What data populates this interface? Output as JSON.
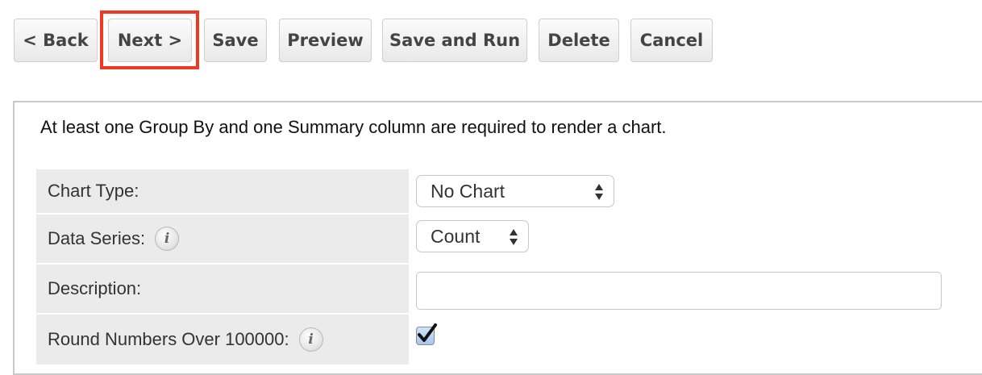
{
  "toolbar": {
    "back_label": "< Back",
    "next_label": "Next >",
    "save_label": "Save",
    "preview_label": "Preview",
    "save_and_run_label": "Save and Run",
    "delete_label": "Delete",
    "cancel_label": "Cancel"
  },
  "highlight_color": "#ee3a22",
  "panel": {
    "notice": "At least one Group By and one Summary column are required to render a chart."
  },
  "form": {
    "chart_type": {
      "label": "Chart Type:",
      "value": "No Chart"
    },
    "data_series": {
      "label": "Data Series:",
      "value": "Count",
      "info_icon": "info-icon"
    },
    "description": {
      "label": "Description:",
      "value": ""
    },
    "round_numbers": {
      "label": "Round Numbers Over 100000:",
      "checked": true,
      "info_icon": "info-icon"
    }
  },
  "info_glyph": "i"
}
